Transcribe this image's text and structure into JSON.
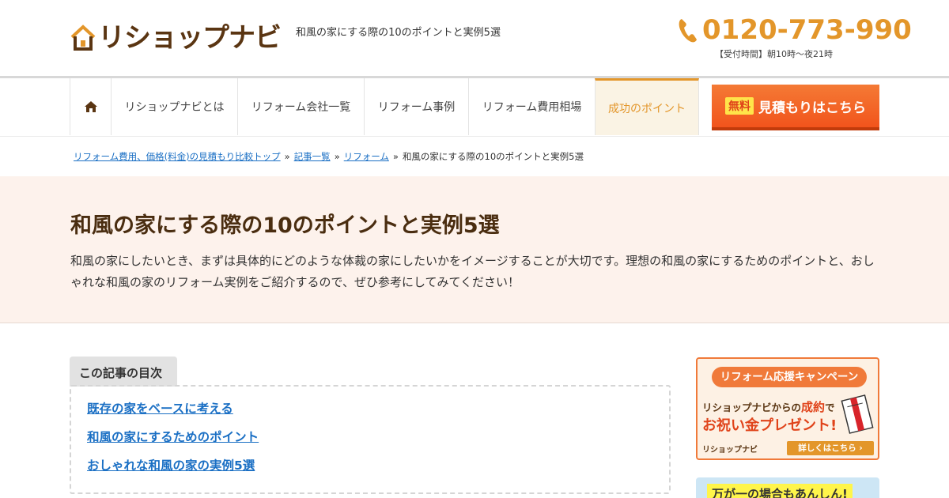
{
  "header": {
    "logo_text": "リショップナビ",
    "tagline": "和風の家にする際の10のポイントと実例5選",
    "phone": "0120-773-990",
    "hours": "【受付時間】朝10時～夜21時"
  },
  "nav": {
    "home_icon": "home-icon",
    "items": [
      {
        "label": "リショップナビとは"
      },
      {
        "label": "リフォーム会社一覧"
      },
      {
        "label": "リフォーム事例"
      },
      {
        "label": "リフォーム費用相場"
      },
      {
        "label": "成功のポイント"
      }
    ],
    "cta_free": "無料",
    "cta_label": "見積もりはこちら"
  },
  "breadcrumb": {
    "items": [
      "リフォーム費用、価格(料金)の見積もり比較トップ",
      "記事一覧",
      "リフォーム"
    ],
    "current": "和風の家にする際の10のポイントと実例5選",
    "separator": "»"
  },
  "hero": {
    "title": "和風の家にする際の10のポイントと実例5選",
    "description": "和風の家にしたいとき、まずは具体的にどのような体裁の家にしたいかをイメージすることが大切です。理想の和風の家にするためのポイントと、おしゃれな和風の家のリフォーム実例をご紹介するので、ぜひ参考にしてみてください！"
  },
  "toc": {
    "title": "この記事の目次",
    "items": [
      "既存の家をベースに考える",
      "和風の家にするためのポイント",
      "おしゃれな和風の家の実例5選"
    ]
  },
  "sidebar": {
    "campaign_head": "リフォーム応援キャンペーン",
    "campaign_line1_a": "リショップナビからの",
    "campaign_line1_b": "成約",
    "campaign_line1_c": "で",
    "campaign_line2": "お祝い金プレゼント!",
    "campaign_logo": "リショップナビ",
    "campaign_button": "詳しくはこちら ›",
    "banner2_text": "万が一の場合もあんしん!"
  },
  "colors": {
    "brand_brown": "#5a3512",
    "accent_orange": "#e3962a",
    "cta_orange": "#f2541c",
    "link_blue": "#1a6fc4",
    "hero_bg": "#fdf2ec"
  }
}
